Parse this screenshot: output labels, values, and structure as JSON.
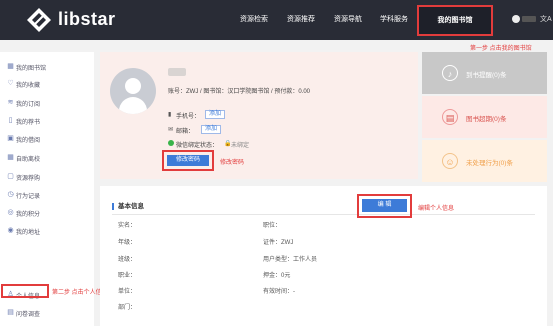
{
  "header": {
    "logo_icon": "libstar-diamond-logo-icon",
    "brand": "libstar",
    "nav": [
      "资源检索",
      "资源推荐",
      "资源导航",
      "学科服务"
    ],
    "nav_active": "我的图书馆",
    "lang_icon": "文A",
    "colors": {
      "background": "#292c36",
      "highlight": "#e23c3c"
    }
  },
  "sidebar": {
    "items": [
      {
        "label": "我的图书馆",
        "icon": "library-icon"
      },
      {
        "label": "我的收藏",
        "icon": "heart-icon"
      },
      {
        "label": "我的订阅",
        "icon": "rss-icon"
      },
      {
        "label": "我的荐书",
        "icon": "book-icon"
      },
      {
        "label": "我的借阅",
        "icon": "borrow-icon"
      },
      {
        "label": "自助离校",
        "icon": "calendar-icon"
      },
      {
        "label": "资源荐购",
        "icon": "shop-icon"
      },
      {
        "label": "行为记录",
        "icon": "record-icon"
      },
      {
        "label": "我的积分",
        "icon": "points-icon"
      },
      {
        "label": "我的地址",
        "icon": "location-icon"
      },
      {
        "label": "个人信息",
        "icon": "user-icon"
      },
      {
        "label": "问卷调查",
        "icon": "survey-icon"
      }
    ]
  },
  "profile": {
    "account_line": "账号：ZWJ / 图书馆：汉口学院图书馆 / 预付款：0.00",
    "phone_label": "手机号：",
    "email_label": "邮箱：",
    "wechat_label": "微信绑定状态：",
    "wechat_status": "未绑定",
    "add_label": "添加",
    "change_password": "修改密码"
  },
  "stats": [
    {
      "label": "到书提醒(0)条",
      "icon": "bell-icon",
      "bg": "#c8c8c8",
      "color": "#ffffff"
    },
    {
      "label": "图书超期(0)条",
      "icon": "overdue-icon",
      "bg": "#fde9e6",
      "color": "#d9534f"
    },
    {
      "label": "未处理行为(0)条",
      "icon": "behavior-icon",
      "bg": "#fff1e2",
      "color": "#f0a04b"
    }
  ],
  "basic_info": {
    "title": "基本信息",
    "edit": "编 辑",
    "left_fields": [
      "实名：",
      "年级：",
      "班级：",
      "职业：",
      "单位：",
      "部门："
    ],
    "right_fields": [
      "职位：",
      "证件：ZWJ",
      "用户类型：工作人员",
      "押金：0元",
      "有效时间：-"
    ]
  },
  "annotations": {
    "step1": "第一步 点击我的图书馆",
    "step2": "第二步 点击个人信息",
    "change_password_hint": "修改密码",
    "edit_hint": "编辑个人信息"
  }
}
